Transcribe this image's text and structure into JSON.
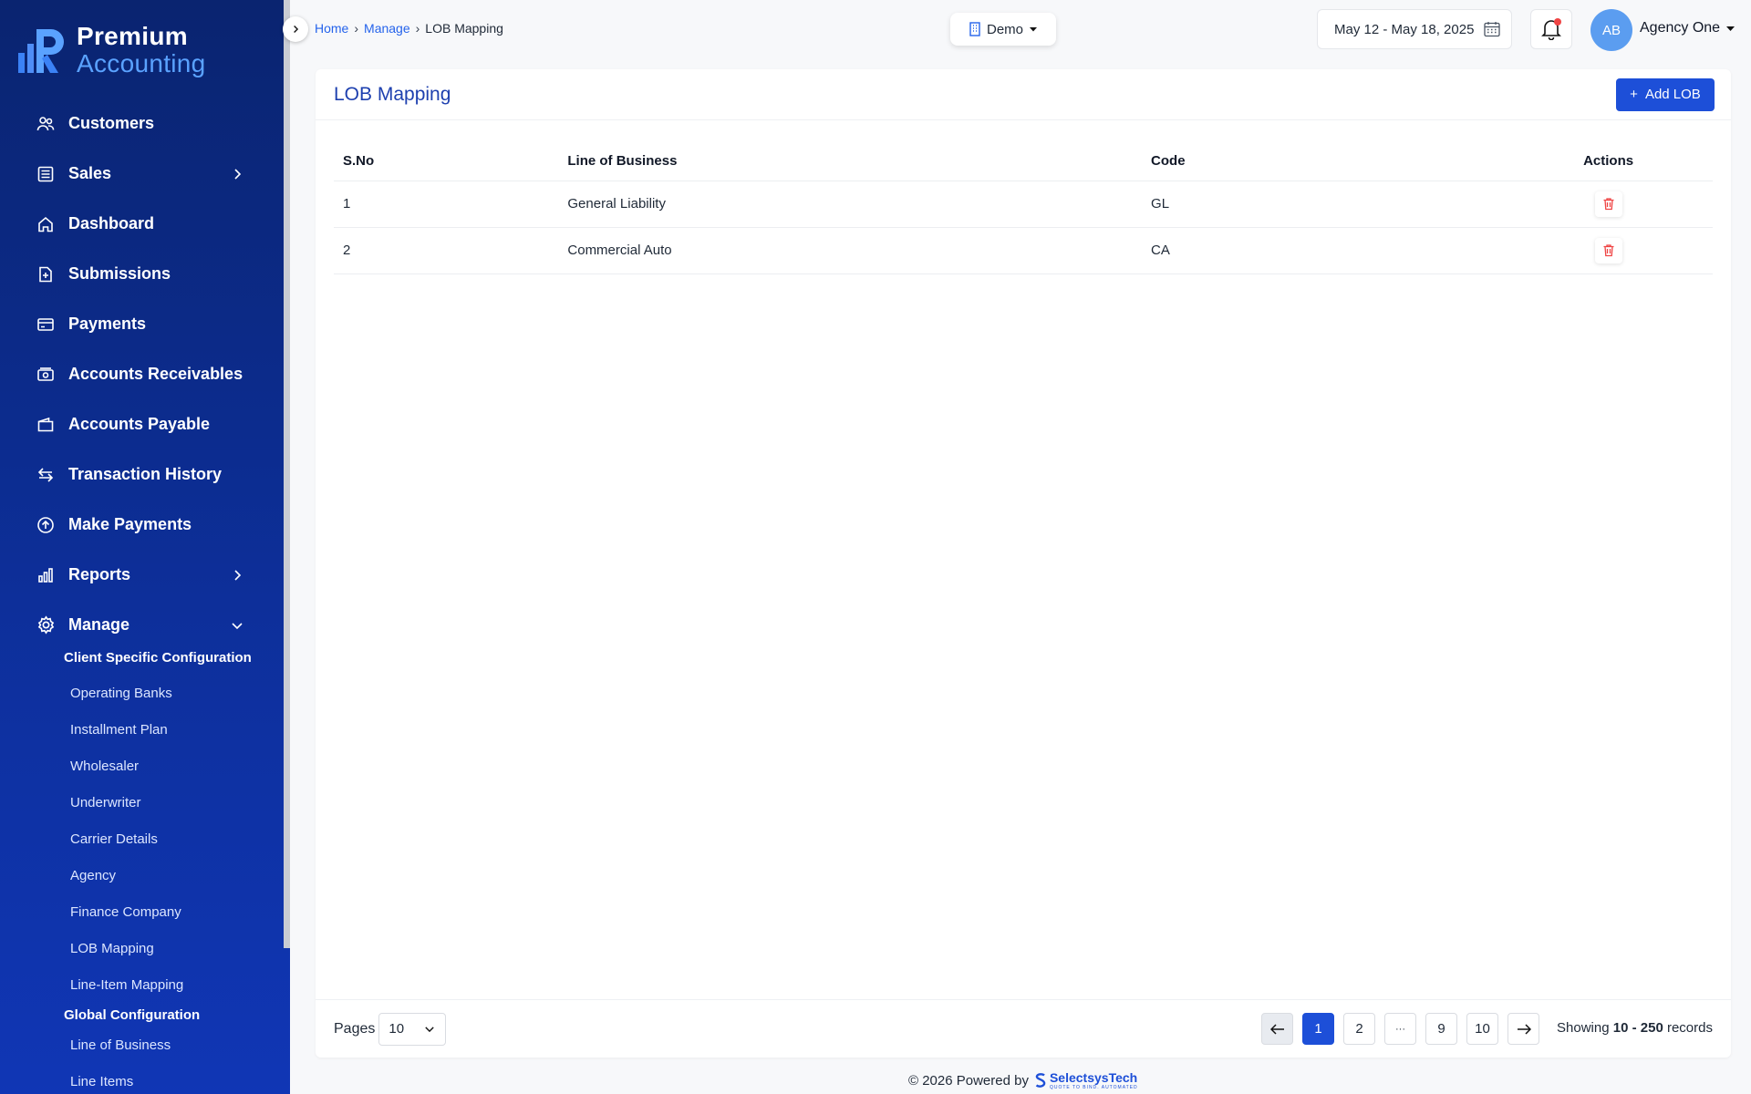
{
  "app": {
    "logo_line1": "Premium",
    "logo_line2": "Accounting"
  },
  "sidebar": {
    "items": [
      {
        "label": "Customers",
        "icon": "users-icon"
      },
      {
        "label": "Sales",
        "icon": "ledger-icon",
        "has_submenu": true
      },
      {
        "label": "Dashboard",
        "icon": "home-icon"
      },
      {
        "label": "Submissions",
        "icon": "file-plus-icon"
      },
      {
        "label": "Payments",
        "icon": "credit-card-icon"
      },
      {
        "label": "Accounts Receivables",
        "icon": "cash-icon"
      },
      {
        "label": "Accounts Payable",
        "icon": "wallet-icon"
      },
      {
        "label": "Transaction History",
        "icon": "arrows-swap-icon"
      },
      {
        "label": "Make Payments",
        "icon": "upload-circle-icon"
      },
      {
        "label": "Reports",
        "icon": "bar-chart-icon",
        "has_submenu": true
      },
      {
        "label": "Manage",
        "icon": "gear-icon",
        "expanded": true
      }
    ],
    "manage_sections": [
      {
        "heading": "Client Specific Configuration",
        "items": [
          "Operating Banks",
          "Installment Plan",
          "Wholesaler",
          "Underwriter",
          "Carrier Details",
          "Agency",
          "Finance Company",
          "LOB Mapping",
          "Line-Item Mapping"
        ]
      },
      {
        "heading": "Global Configuration",
        "items": [
          "Line of Business",
          "Line Items"
        ]
      }
    ]
  },
  "header": {
    "breadcrumb": {
      "home": "Home",
      "sep1": "›",
      "manage": "Manage",
      "sep2": "›",
      "current": "LOB Mapping"
    },
    "environment": "Demo",
    "date_range": "May 12 - May 18, 2025",
    "avatar_initials": "AB",
    "user_name": "Agency One"
  },
  "page": {
    "title": "LOB Mapping",
    "add_button": "Add LOB",
    "add_icon": "+",
    "columns": [
      "S.No",
      "Line of Business",
      "Code",
      "Actions"
    ],
    "rows": [
      {
        "sno": "1",
        "lob": "General Liability",
        "code": "GL"
      },
      {
        "sno": "2",
        "lob": "Commercial Auto",
        "code": "CA"
      }
    ]
  },
  "pagination": {
    "pages_label": "Pages",
    "page_size": "10",
    "pages": [
      "1",
      "2",
      "···",
      "9",
      "10"
    ],
    "current_page": "1",
    "showing_prefix": "Showing",
    "showing_range": "10 - 250",
    "showing_suffix": "records"
  },
  "footer": {
    "powered_text": "© 2026 Powered by",
    "brand": "SelectsysTech",
    "brand_tagline": "QUOTE TO BIND. AUTOMATED"
  },
  "colors": {
    "sidebar_top": "#0a2470",
    "sidebar_bottom": "#1036b5",
    "primary": "#1d4fd8",
    "danger": "#ef4444"
  }
}
